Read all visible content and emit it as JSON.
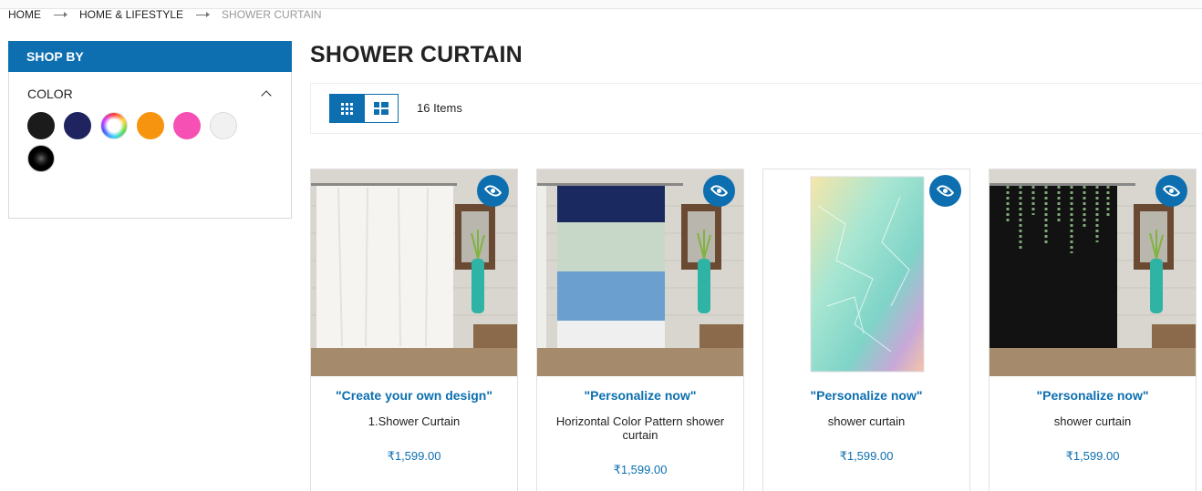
{
  "breadcrumb": {
    "home": "HOME",
    "category": "HOME & LIFESTYLE",
    "current": "SHOWER CURTAIN"
  },
  "sidebar": {
    "heading": "SHOP BY",
    "filter_title": "COLOR",
    "swatches": [
      {
        "name": "black",
        "color": "#1b1b1b"
      },
      {
        "name": "navy",
        "color": "#1f2460"
      },
      {
        "name": "multicolor",
        "color": "conic"
      },
      {
        "name": "orange",
        "color": "#f7940f"
      },
      {
        "name": "pink",
        "color": "#f650b4"
      },
      {
        "name": "white",
        "color": "#f1f1f1"
      },
      {
        "name": "black-gradient",
        "color": "#000000"
      }
    ]
  },
  "main": {
    "title": "SHOWER CURTAIN",
    "item_count": "16 Items"
  },
  "products": [
    {
      "cta": "\"Create your own design\"",
      "name": "1.Shower Curtain",
      "price": "₹1,599.00"
    },
    {
      "cta": "\"Personalize now\"",
      "name": "Horizontal Color Pattern shower curtain",
      "price": "₹1,599.00"
    },
    {
      "cta": "\"Personalize now\"",
      "name": "shower curtain",
      "price": "₹1,599.00"
    },
    {
      "cta": "\"Personalize now\"",
      "name": "shower curtain",
      "price": "₹1,599.00"
    }
  ],
  "colors": {
    "accent": "#0d6fb0"
  }
}
